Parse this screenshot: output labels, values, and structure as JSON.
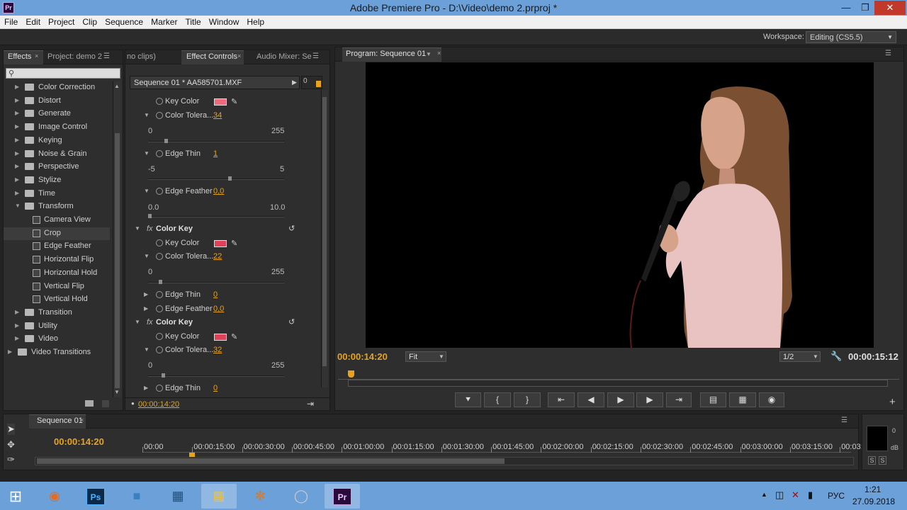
{
  "window": {
    "title": "Adobe Premiere Pro - D:\\Video\\demo 2.prproj *",
    "logo": "Pr"
  },
  "menu": [
    "File",
    "Edit",
    "Project",
    "Clip",
    "Sequence",
    "Marker",
    "Title",
    "Window",
    "Help"
  ],
  "workspace": {
    "label": "Workspace:",
    "value": "Editing (CS5.5)"
  },
  "left_panel": {
    "tabs": [
      "Effects",
      "Project: demo 2"
    ],
    "tree": [
      {
        "label": "Color Correction",
        "type": "folder",
        "level": 1
      },
      {
        "label": "Distort",
        "type": "folder",
        "level": 1
      },
      {
        "label": "Generate",
        "type": "folder",
        "level": 1
      },
      {
        "label": "Image Control",
        "type": "folder",
        "level": 1
      },
      {
        "label": "Keying",
        "type": "folder",
        "level": 1
      },
      {
        "label": "Noise & Grain",
        "type": "folder",
        "level": 1
      },
      {
        "label": "Perspective",
        "type": "folder",
        "level": 1
      },
      {
        "label": "Stylize",
        "type": "folder",
        "level": 1
      },
      {
        "label": "Time",
        "type": "folder",
        "level": 1
      },
      {
        "label": "Transform",
        "type": "folder-open",
        "level": 1
      },
      {
        "label": "Camera View",
        "type": "effect",
        "level": 2
      },
      {
        "label": "Crop",
        "type": "effect",
        "level": 2,
        "selected": true
      },
      {
        "label": "Edge Feather",
        "type": "effect",
        "level": 2
      },
      {
        "label": "Horizontal Flip",
        "type": "effect",
        "level": 2
      },
      {
        "label": "Horizontal Hold",
        "type": "effect",
        "level": 2
      },
      {
        "label": "Vertical Flip",
        "type": "effect",
        "level": 2
      },
      {
        "label": "Vertical Hold",
        "type": "effect",
        "level": 2
      },
      {
        "label": "Transition",
        "type": "folder",
        "level": 1
      },
      {
        "label": "Utility",
        "type": "folder",
        "level": 1
      },
      {
        "label": "Video",
        "type": "folder",
        "level": 1
      },
      {
        "label": "Video Transitions",
        "type": "folder",
        "level": 0
      }
    ]
  },
  "effect_controls": {
    "tabs": [
      "no clips)",
      "Effect Controls",
      "Audio Mixer: Se"
    ],
    "header": "Sequence 01 * AA585701.MXF",
    "ruler": "0",
    "fx1": {
      "key_color_label": "Key Color",
      "key_color": "#f06a7e",
      "tol_label": "Color Tolera...",
      "tol_val": "34",
      "tol_min": "0",
      "tol_max": "255",
      "thin_label": "Edge Thin",
      "thin_val": "1",
      "thin_min": "-5",
      "thin_max": "5",
      "feather_label": "Edge Feather",
      "feather_val": "0,0",
      "feather_min": "0.0",
      "feather_max": "10.0"
    },
    "fx2": {
      "name": "Color Key",
      "fx": "fx",
      "key_color_label": "Key Color",
      "key_color": "#e04058",
      "tol_label": "Color Tolera...",
      "tol_val": "22",
      "tol_min": "0",
      "tol_max": "255",
      "thin_label": "Edge Thin",
      "thin_val": "0",
      "feather_label": "Edge Feather",
      "feather_val": "0,0"
    },
    "fx3": {
      "name": "Color Key",
      "fx": "fx",
      "key_color_label": "Key Color",
      "key_color": "#e04058",
      "tol_label": "Color Tolera...",
      "tol_val": "32",
      "tol_min": "0",
      "tol_max": "255",
      "thin_label": "Edge Thin",
      "thin_val": "0"
    },
    "timecode": "00:00:14:20"
  },
  "program_monitor": {
    "tab": "Program: Sequence 01",
    "timecode_current": "00:00:14:20",
    "fit": "Fit",
    "resolution": "1/2",
    "timecode_duration": "00:00:15:12"
  },
  "timeline": {
    "tab": "Sequence 01",
    "timecode": "00:00:14:20",
    "ruler": [
      "00:00",
      "00:00:15:00",
      "00:00:30:00",
      "00:00:45:00",
      "00:01:00:00",
      "00:01:15:00",
      "00:01:30:00",
      "00:01:45:00",
      "00:02:00:00",
      "00:02:15:00",
      "00:02:30:00",
      "00:02:45:00",
      "00:03:00:00",
      "00:03:15:00",
      "00:03:30"
    ],
    "meter_labels": [
      "0",
      "dB"
    ],
    "solo": [
      "S",
      "S"
    ]
  },
  "taskbar": {
    "time": "1:21",
    "date": "27.09.2018",
    "lang": "РУС"
  }
}
